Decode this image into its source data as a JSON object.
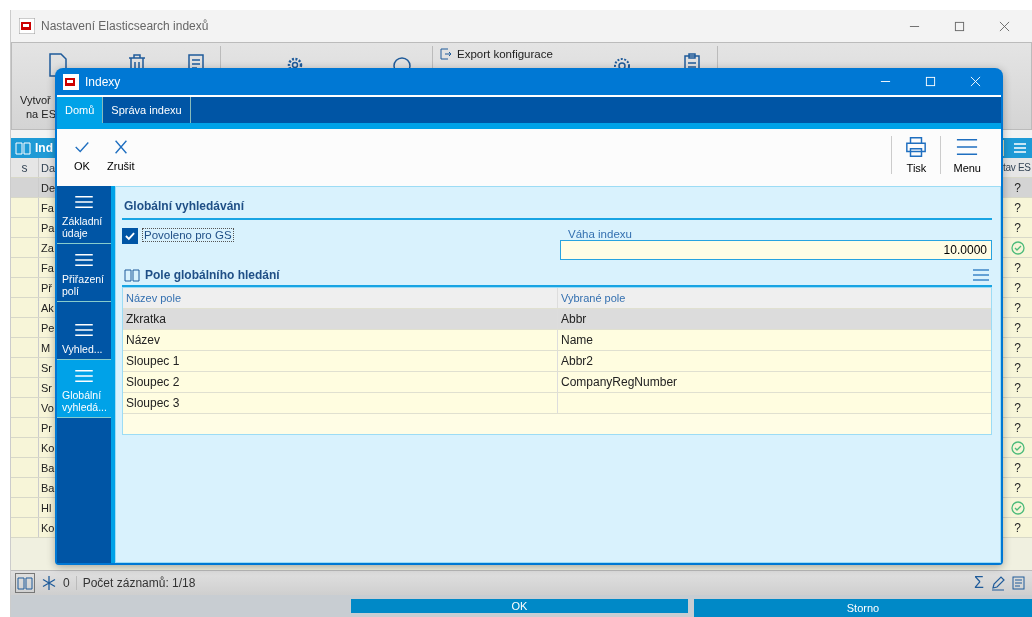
{
  "main_window": {
    "title": "Nastavení Elasticsearch indexů",
    "toolbar": {
      "create_label": [
        "Vytvoř",
        "na ES"
      ],
      "export_label": "Export konfigurace"
    },
    "grid": {
      "header_title": "Ind",
      "columns": [
        "s",
        "Da",
        "tav ES"
      ],
      "rows": [
        {
          "cell": "De",
          "kind": "text",
          "status_text": "?",
          "selected": true
        },
        {
          "cell": "Fa",
          "kind": "text",
          "status_text": "?",
          "selected": false
        },
        {
          "cell": "Pa",
          "kind": "text",
          "status_text": "?",
          "selected": false
        },
        {
          "cell": "Za",
          "kind": "check",
          "selected": false
        },
        {
          "cell": "Fa",
          "kind": "text",
          "status_text": "?",
          "selected": false
        },
        {
          "cell": "Př",
          "kind": "text",
          "status_text": "?",
          "selected": false
        },
        {
          "cell": "Ak",
          "kind": "text",
          "status_text": "?",
          "selected": false
        },
        {
          "cell": "Pe",
          "kind": "text",
          "status_text": "?",
          "selected": false
        },
        {
          "cell": "M",
          "kind": "text",
          "status_text": "?",
          "selected": false
        },
        {
          "cell": "Sr",
          "kind": "text",
          "status_text": "?",
          "selected": false
        },
        {
          "cell": "Sr",
          "kind": "text",
          "status_text": "?",
          "selected": false
        },
        {
          "cell": "Vo",
          "kind": "text",
          "status_text": "?",
          "selected": false
        },
        {
          "cell": "Pr",
          "kind": "text",
          "status_text": "?",
          "selected": false
        },
        {
          "cell": "Ko",
          "kind": "check",
          "selected": false
        },
        {
          "cell": "Ba",
          "kind": "text",
          "status_text": "?",
          "selected": false
        },
        {
          "cell": "Ba",
          "kind": "text",
          "status_text": "?",
          "selected": false
        },
        {
          "cell": "Hl",
          "kind": "check",
          "selected": false
        },
        {
          "cell": "Ko",
          "kind": "text",
          "status_text": "?",
          "selected": false
        }
      ]
    },
    "status_bar": {
      "count": "0",
      "records": "Počet záznamů: 1/18",
      "sum_symbol": "Σ"
    },
    "buttons": [
      "OK",
      "Storno"
    ]
  },
  "dialog": {
    "title": "Indexy",
    "tabs": [
      {
        "label": "Domů",
        "selected": true
      },
      {
        "label": "Správa indexu",
        "selected": false
      }
    ],
    "actions_left": [
      "OK",
      "Zrušit"
    ],
    "actions_right": [
      "Tisk",
      "Menu"
    ],
    "nav": [
      {
        "label": "Základní údaje",
        "selected": false
      },
      {
        "label": "Přiřazení polí",
        "selected": false
      },
      {
        "label": "Vyhled...",
        "selected": false
      },
      {
        "label": "Globální vyhledá...",
        "selected": true
      }
    ],
    "section": {
      "title": "Globální vyhledávání",
      "checkbox": {
        "label": "Povoleno pro GS",
        "checked": true
      },
      "weight": {
        "label": "Váha indexu",
        "value": "10.0000"
      }
    },
    "fields_table": {
      "title": "Pole globálního hledání",
      "columns": [
        "Název pole",
        "Vybrané pole"
      ],
      "rows": [
        {
          "name": "Zkratka",
          "field": "Abbr",
          "selected": true
        },
        {
          "name": "Název",
          "field": "Name",
          "selected": false
        },
        {
          "name": "Sloupec 1",
          "field": "Abbr2",
          "selected": false
        },
        {
          "name": "Sloupec 2",
          "field": "CompanyRegNumber",
          "selected": false
        },
        {
          "name": "Sloupec 3",
          "selected": false
        }
      ]
    }
  }
}
